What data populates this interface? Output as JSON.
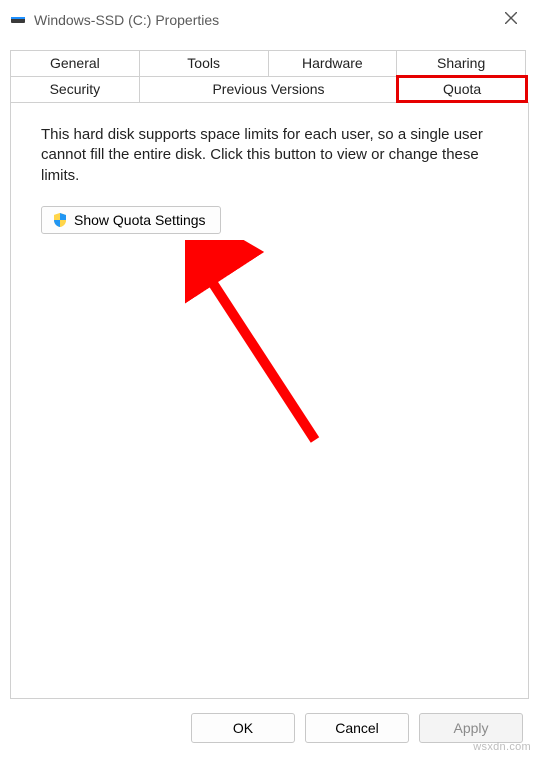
{
  "window": {
    "title": "Windows-SSD (C:) Properties"
  },
  "tabs": {
    "row1": [
      "General",
      "Tools",
      "Hardware",
      "Sharing"
    ],
    "row2": [
      "Security",
      "Previous Versions",
      "Quota"
    ],
    "active": "Quota",
    "highlighted": "Quota"
  },
  "panel": {
    "description": "This hard disk supports space limits for each user, so a single user cannot fill the entire disk. Click this button to view or change these limits.",
    "button_label": "Show Quota Settings"
  },
  "footer": {
    "ok": "OK",
    "cancel": "Cancel",
    "apply": "Apply"
  },
  "annotation": {
    "highlight_color": "#e60000",
    "arrow_color": "#ff0000"
  },
  "watermark": "wsxdn.com"
}
